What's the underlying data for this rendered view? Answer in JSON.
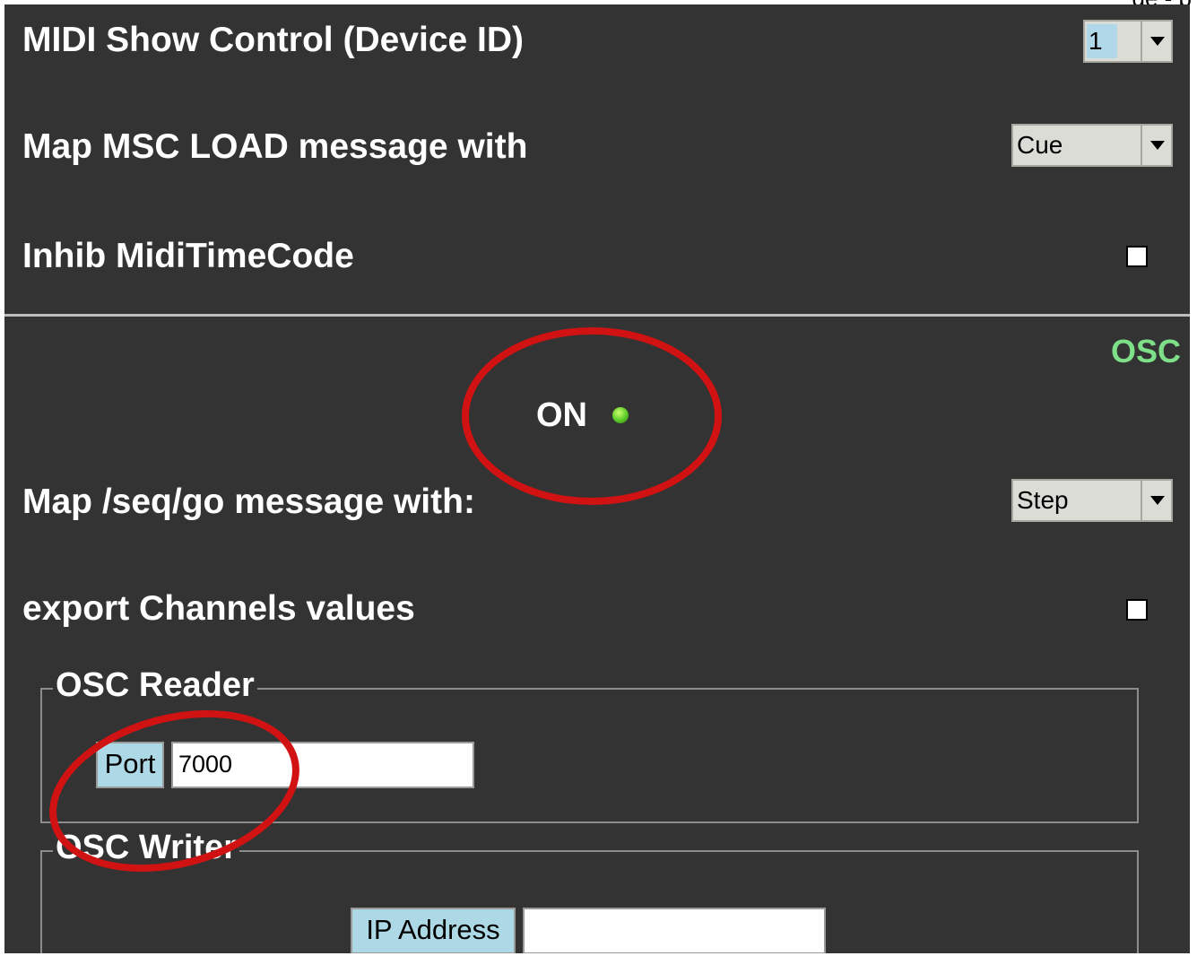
{
  "top_cut_text": "ge - p",
  "midi": {
    "msc_label": "MIDI Show Control (Device ID)",
    "device_id": "1",
    "load_label": "Map MSC LOAD message with",
    "load_value": "Cue",
    "inhib_label": "Inhib MidiTimeCode"
  },
  "osc": {
    "title": "OSC",
    "status": "ON",
    "status_color": "#59c928",
    "seq_go_label": "Map /seq/go message with:",
    "seq_go_value": "Step",
    "export_label": "export Channels values",
    "reader": {
      "title": "OSC Reader",
      "port_label": "Port",
      "port_value": "7000"
    },
    "writer": {
      "title": "OSC Writer",
      "ip_label": "IP Address",
      "ip_value": ""
    }
  },
  "annotation_color": "#d11212"
}
